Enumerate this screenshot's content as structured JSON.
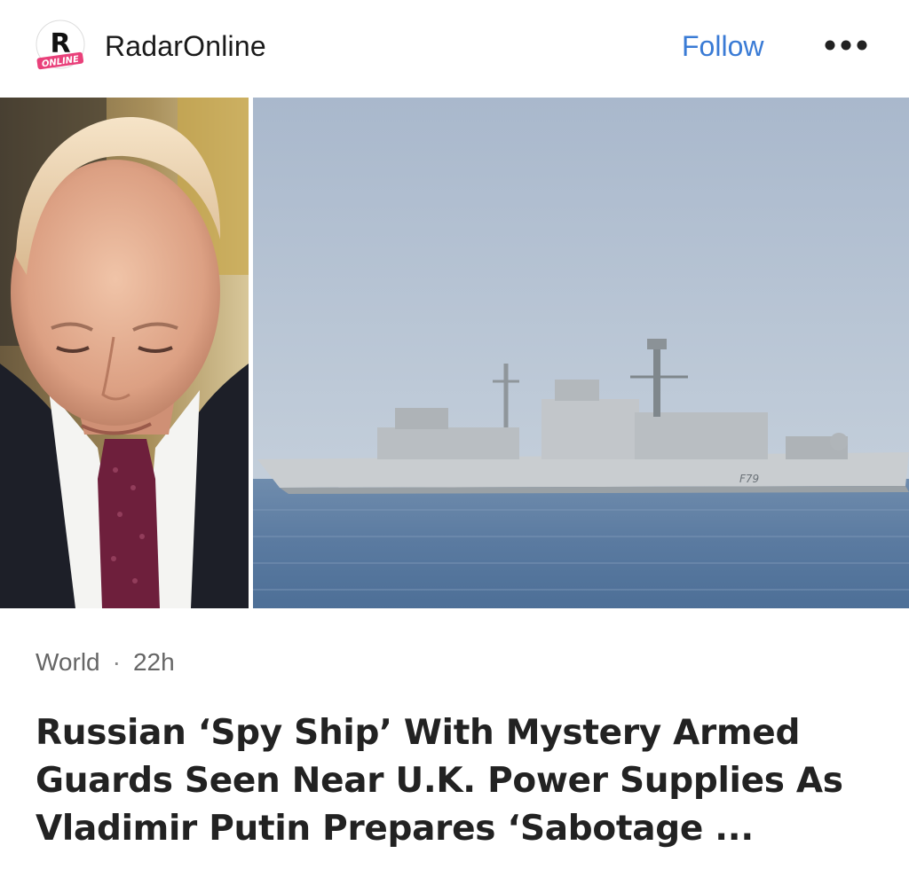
{
  "publisher": {
    "name": "RadarOnline",
    "logo_letter": "R",
    "logo_tag": "ONLINE",
    "logo_color": "#e9407a"
  },
  "actions": {
    "follow_label": "Follow",
    "more_icon": "more-dots-icon"
  },
  "article": {
    "category": "World",
    "age": "22h",
    "separator": "·",
    "title": "Russian ‘Spy Ship’ With Mystery Armed Guards Seen Near U.K. Power Supplies As Vladimir Putin Prepares ‘Sabotage ...",
    "ship_marking": "F79"
  },
  "colors": {
    "accent": "#3a7bd5",
    "text": "#222222",
    "muted": "#666666"
  }
}
